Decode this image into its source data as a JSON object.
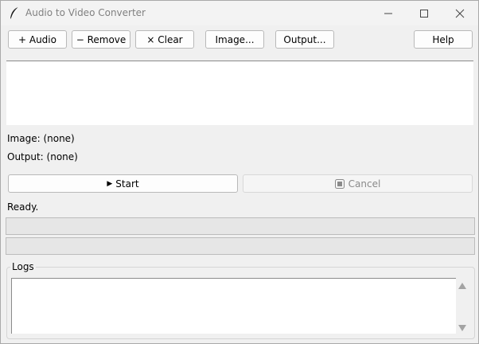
{
  "window": {
    "title": "Audio to Video Converter",
    "icons": {
      "app": "feather-icon",
      "minimize": "minimize-icon",
      "maximize": "maximize-icon",
      "close": "close-icon"
    }
  },
  "toolbar": {
    "add_audio": "+ Audio",
    "remove": "− Remove",
    "clear": "× Clear",
    "image": "Image...",
    "output": "Output...",
    "help": "Help"
  },
  "info": {
    "image": "Image: (none)",
    "output": "Output: (none)"
  },
  "actions": {
    "start_icon": "▶",
    "start": "Start",
    "cancel": "Cancel"
  },
  "status": {
    "text": "Ready.",
    "progress_overall": 0,
    "progress_current": 0
  },
  "logs": {
    "label": "Logs",
    "content": ""
  },
  "colors": {
    "background": "#f0f0f0",
    "button": "#fdfdfd",
    "disabled_text": "#8a8a8a",
    "progress_trough": "#e6e6e6"
  }
}
